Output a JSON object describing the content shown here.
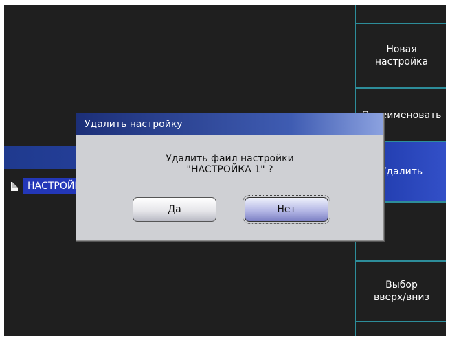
{
  "list": {
    "selected_item": "НАСТРОЙКА 1"
  },
  "softkeys": [
    {
      "label": ""
    },
    {
      "label": "Новая\nнастройка"
    },
    {
      "label": "Переименовать"
    },
    {
      "label": "Удалить"
    },
    {
      "label": ""
    },
    {
      "label": "Выбор\nвверх/вниз"
    },
    {
      "label": ""
    }
  ],
  "dialog": {
    "title": "Удалить настройку",
    "message_line1": "Удалить файл настройки",
    "message_line2": "\"НАСТРОЙКА 1\" ?",
    "yes_label": "Да",
    "no_label": "Нет"
  },
  "colors": {
    "background": "#1f1f1f",
    "accent_blue": "#2337b8",
    "divider": "#2d8d9a",
    "dialog_bg": "#cfd0d4"
  }
}
